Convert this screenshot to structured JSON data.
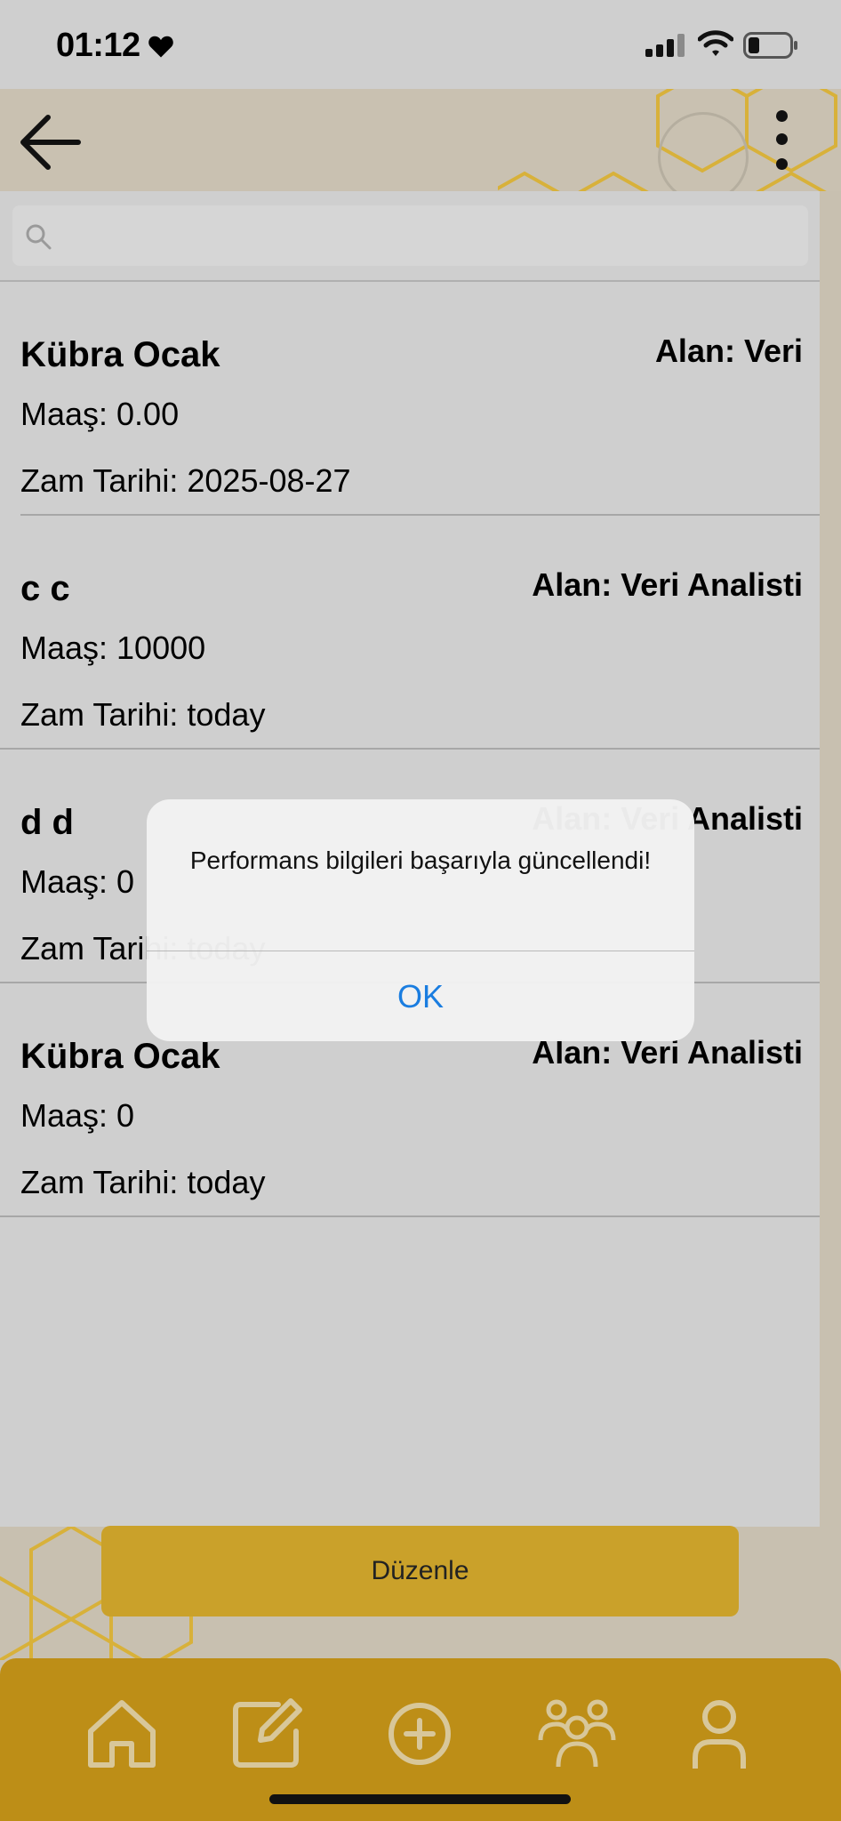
{
  "status_bar": {
    "time": "01:12"
  },
  "search": {
    "placeholder": "",
    "value": ""
  },
  "list": {
    "items": [
      {
        "name": "Kübra Ocak",
        "area": "Alan: Veri",
        "salary": "Maaş: 0.00",
        "raise_date": "Zam Tarihi: 2025-08-27"
      },
      {
        "name": "c c",
        "area": "Alan: Veri Analisti",
        "salary": "Maaş: 10000",
        "raise_date": "Zam Tarihi: today"
      },
      {
        "name": "d d",
        "area": "Alan: Veri Analisti",
        "salary": "Maaş: 0",
        "raise_date": "Zam Tarihi: today"
      },
      {
        "name": "Kübra Ocak",
        "area": "Alan: Veri Analisti",
        "salary": "Maaş: 0",
        "raise_date": "Zam Tarihi: today"
      }
    ]
  },
  "edit_button": {
    "label": "Düzenle"
  },
  "alert": {
    "message": "Performans bilgileri başarıyla güncellendi!",
    "ok_label": "OK"
  },
  "colors": {
    "accent": "#caa12a",
    "nav_bg": "#bd8e17",
    "link_blue": "#1a7de0"
  },
  "bottom_nav": {
    "items": [
      {
        "icon": "home-icon"
      },
      {
        "icon": "edit-icon"
      },
      {
        "icon": "add-circle-icon"
      },
      {
        "icon": "team-icon"
      },
      {
        "icon": "user-icon"
      }
    ]
  }
}
